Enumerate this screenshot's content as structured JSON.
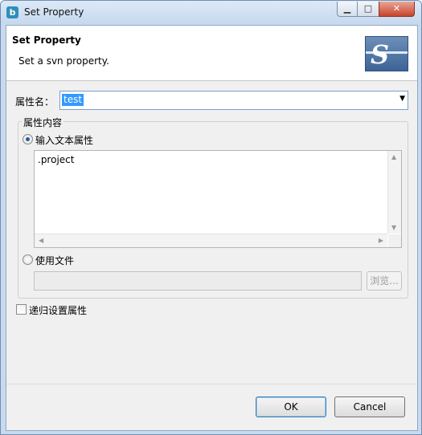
{
  "window": {
    "title": "Set Property",
    "app_icon": "b",
    "controls": {
      "minimize": "▁",
      "maximize": "□",
      "close": "✕"
    }
  },
  "header": {
    "title": "Set Property",
    "description": "Set a svn property.",
    "logo": "S"
  },
  "property": {
    "label": "属性名：",
    "value": "test"
  },
  "content_group": {
    "caption": "属性内容",
    "text_option_label": "输入文本属性",
    "text_value": ".project",
    "file_option_label": "使用文件",
    "file_value": "",
    "browse_label": "浏览..."
  },
  "recursive": {
    "label": "递归设置属性",
    "checked": false
  },
  "buttons": {
    "ok": "OK",
    "cancel": "Cancel"
  },
  "colors": {
    "selection": "#3399ff",
    "title_bar": "#c9daee",
    "close_button": "#c8442b"
  },
  "icons": {
    "app": "svn-app-icon",
    "logo": "svn-logo-icon",
    "dropdown": "dropdown-arrow-icon"
  }
}
